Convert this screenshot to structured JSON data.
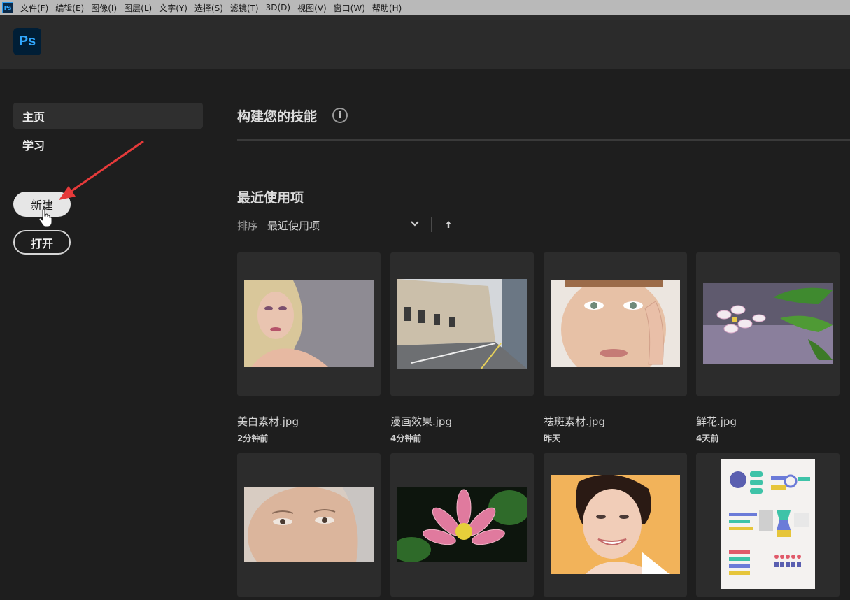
{
  "menubar": {
    "app_icon": "Ps",
    "items": [
      "文件(F)",
      "编辑(E)",
      "图像(I)",
      "图层(L)",
      "文字(Y)",
      "选择(S)",
      "滤镜(T)",
      "3D(D)",
      "视图(V)",
      "窗口(W)",
      "帮助(H)"
    ]
  },
  "header": {
    "logo": "Ps"
  },
  "sidebar": {
    "nav": [
      "主页",
      "学习"
    ],
    "new_button": "新建",
    "open_button": "打开"
  },
  "main": {
    "skills_title": "构建您的技能",
    "info_icon": "i",
    "recent_title": "最近使用项",
    "sort_label": "排序",
    "sort_value": "最近使用项"
  },
  "files": [
    {
      "name": "美白素材.jpg",
      "time": "2分钟前",
      "thumb": "portrait-blonde"
    },
    {
      "name": "漫画效果.jpg",
      "time": "4分钟前",
      "thumb": "street"
    },
    {
      "name": "祛斑素材.jpg",
      "time": "昨天",
      "thumb": "portrait-freckles"
    },
    {
      "name": "鲜花.jpg",
      "time": "4天前",
      "thumb": "flower"
    },
    {
      "thumb": "portrait-elder"
    },
    {
      "thumb": "lotus"
    },
    {
      "thumb": "portrait-smile"
    },
    {
      "thumb": "infographic"
    }
  ],
  "colors": {
    "accent": "#31a8ff",
    "background": "#1e1e1e",
    "card": "#2c2c2c",
    "annotation_arrow": "#e63a3a"
  }
}
